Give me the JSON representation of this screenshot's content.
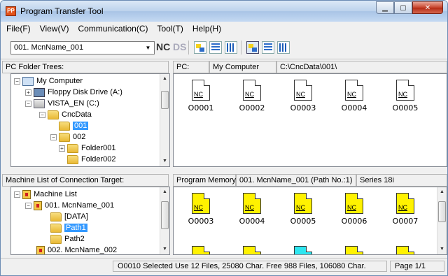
{
  "window": {
    "title": "Program Transfer Tool",
    "icon_name": "app-icon",
    "icon_text": "PP",
    "buttons": {
      "minimize": "▁",
      "maximize": "▢",
      "close": "✕"
    }
  },
  "menu": [
    "File(F)",
    "View(V)",
    "Communication(C)",
    "Tool(T)",
    "Help(H)"
  ],
  "toolbar": {
    "connection_value": "001. McnName_001",
    "nc_label": "NC",
    "ds_label": "DS"
  },
  "pc_tree": {
    "header": "PC Folder Trees:",
    "items": [
      {
        "label": "My Computer",
        "icon": "computer-icon"
      },
      {
        "label": "Floppy Disk Drive (A:)",
        "icon": "floppy-icon"
      },
      {
        "label": "VISTA_EN (C:)",
        "icon": "drive-icon"
      },
      {
        "label": "CncData",
        "icon": "folder-icon"
      },
      {
        "label": "001",
        "icon": "folder-icon"
      },
      {
        "label": "002",
        "icon": "folder-icon"
      },
      {
        "label": "Folder001",
        "icon": "folder-icon"
      },
      {
        "label": "Folder002",
        "icon": "folder-icon"
      }
    ]
  },
  "pc_view": {
    "header_label": "PC:",
    "header_location": "My Computer",
    "header_path": "C:\\CncData\\001\\",
    "files": [
      "O0001",
      "O0002",
      "O0003",
      "O0004",
      "O0005"
    ],
    "nc_tag": "NC"
  },
  "machine_tree": {
    "header": "Machine List of Connection Target:",
    "items": [
      {
        "label": "Machine List",
        "icon": "machine-icon"
      },
      {
        "label": "001. McnName_001",
        "icon": "machine-icon"
      },
      {
        "label": "[DATA]",
        "icon": "folder-icon"
      },
      {
        "label": "Path1",
        "icon": "folder-icon"
      },
      {
        "label": "Path2",
        "icon": "folder-icon"
      },
      {
        "label": "002. McnName_002",
        "icon": "machine-icon"
      }
    ]
  },
  "machine_view": {
    "header_label": "Program Memory:",
    "header_path": "001. McnName_001 (Path No.:1)",
    "header_series": "Series 18i",
    "files": [
      "O0003",
      "O0004",
      "O0005",
      "O0006",
      "O0007"
    ],
    "nc_tag": "NC"
  },
  "status": {
    "summary": "O0010 Selected  Use 12 Files, 25080 Char.  Free 988 Files, 106080 Char.",
    "page": "Page 1/1"
  },
  "colors": {
    "selection": "#3399ff",
    "program_file": "#fff200",
    "highlight_file": "#2ee6f0"
  }
}
